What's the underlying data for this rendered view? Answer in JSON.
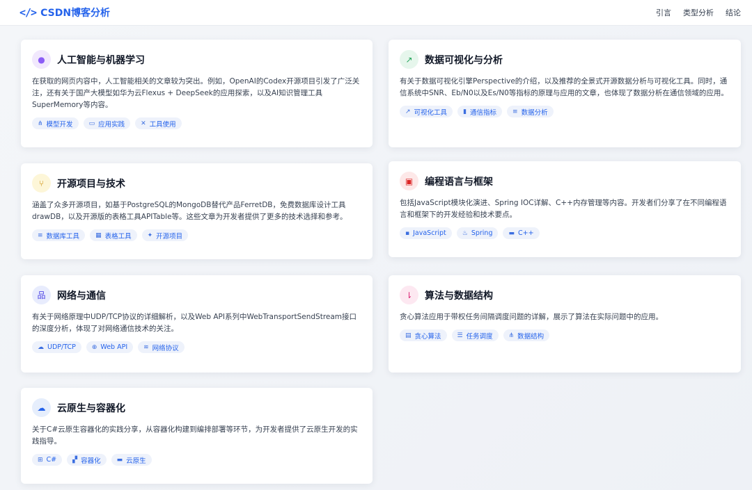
{
  "header": {
    "brand_icon": "</>",
    "brand": "CSDN博客分析",
    "nav": [
      "引言",
      "类型分析",
      "结论"
    ]
  },
  "cards": [
    {
      "icon": "brain-icon",
      "icon_glyph": "●",
      "icon_bg": "#f1e8fd",
      "icon_color": "#8b5cf6",
      "title": "人工智能与机器学习",
      "desc": "在获取的网页内容中，人工智能相关的文章较为突出。例如，OpenAI的Codex开源项目引发了广泛关注，还有关于国产大模型如华为云Flexus + DeepSeek的应用探索，以及AI知识管理工具SuperMemory等内容。",
      "tags": [
        {
          "icon": "network-icon",
          "glyph": "⋔",
          "label": "模型开发"
        },
        {
          "icon": "laptop-icon",
          "glyph": "▭",
          "label": "应用实践"
        },
        {
          "icon": "tools-icon",
          "glyph": "✕",
          "label": "工具使用"
        }
      ]
    },
    {
      "icon": "chart-line-icon",
      "icon_glyph": "↗",
      "icon_bg": "#e6f6ec",
      "icon_color": "#22a35a",
      "title": "数据可视化与分析",
      "desc": "有关于数据可视化引擎Perspective的介绍，以及推荐的全景式开源数据分析与可视化工具。同时，通信系统中SNR、Eb/N0以及Es/N0等指标的原理与应用的文章，也体现了数据分析在通信领域的应用。",
      "tags": [
        {
          "icon": "line-chart-icon",
          "glyph": "↗",
          "label": "可视化工具"
        },
        {
          "icon": "signal-icon",
          "glyph": "▮",
          "label": "通信指标"
        },
        {
          "icon": "database-icon",
          "glyph": "≡",
          "label": "数据分析"
        }
      ]
    },
    {
      "icon": "branch-icon",
      "icon_glyph": "⑂",
      "icon_bg": "#fdf6d8",
      "icon_color": "#ca8a04",
      "title": "开源项目与技术",
      "desc": "涵盖了众多开源项目，如基于PostgreSQL的MongoDB替代产品FerretDB，免费数据库设计工具drawDB，以及开源版的表格工具APITable等。这些文章为开发者提供了更多的技术选择和参考。",
      "tags": [
        {
          "icon": "database-icon",
          "glyph": "≡",
          "label": "数据库工具"
        },
        {
          "icon": "table-icon",
          "glyph": "▦",
          "label": "表格工具"
        },
        {
          "icon": "handshake-icon",
          "glyph": "✦",
          "label": "开源项目"
        }
      ]
    },
    {
      "icon": "code-icon",
      "icon_glyph": "▣",
      "icon_bg": "#fde8e8",
      "icon_color": "#dc2626",
      "title": "编程语言与框架",
      "desc": "包括JavaScript模块化演进、Spring IOC详解、C++内存管理等内容。开发者们分享了在不同编程语言和框架下的开发经验和技术要点。",
      "tags": [
        {
          "icon": "js-icon",
          "glyph": "▪",
          "label": "JavaScript"
        },
        {
          "icon": "leaf-icon",
          "glyph": "♨",
          "label": "Spring"
        },
        {
          "icon": "cpp-icon",
          "glyph": "▬",
          "label": "C++"
        }
      ]
    },
    {
      "icon": "sitemap-icon",
      "icon_glyph": "品",
      "icon_bg": "#e8ecfd",
      "icon_color": "#4f46e5",
      "title": "网络与通信",
      "desc": "有关于网络原理中UDP/TCP协议的详细解析，以及Web API系列中WebTransportSendStream接口的深度分析，体现了对网络通信技术的关注。",
      "tags": [
        {
          "icon": "cloud-icon",
          "glyph": "☁",
          "label": "UDP/TCP"
        },
        {
          "icon": "globe-icon",
          "glyph": "⊕",
          "label": "Web API"
        },
        {
          "icon": "wifi-icon",
          "glyph": "≋",
          "label": "网络协议"
        }
      ]
    },
    {
      "icon": "sort-icon",
      "icon_glyph": "⇂",
      "icon_bg": "#fde8f1",
      "icon_color": "#db2777",
      "title": "算法与数据结构",
      "desc": "贪心算法应用于带权任务间隔调度问题的详解，展示了算法在实际问题中的应用。",
      "tags": [
        {
          "icon": "calculator-icon",
          "glyph": "▤",
          "label": "贪心算法"
        },
        {
          "icon": "list-icon",
          "glyph": "☰",
          "label": "任务调度"
        },
        {
          "icon": "network-icon",
          "glyph": "⋔",
          "label": "数据结构"
        }
      ]
    },
    {
      "icon": "cloud-icon",
      "icon_glyph": "☁",
      "icon_bg": "#e6eefc",
      "icon_color": "#2563eb",
      "title": "云原生与容器化",
      "desc": "关于C#云原生容器化的实践分享，从容器化构建到编排部署等环节，为开发者提供了云原生开发的实践指导。",
      "tags": [
        {
          "icon": "windows-icon",
          "glyph": "⊞",
          "label": "C#"
        },
        {
          "icon": "boxes-icon",
          "glyph": "▞",
          "label": "容器化"
        },
        {
          "icon": "server-icon",
          "glyph": "▬",
          "label": "云原生"
        }
      ]
    }
  ]
}
